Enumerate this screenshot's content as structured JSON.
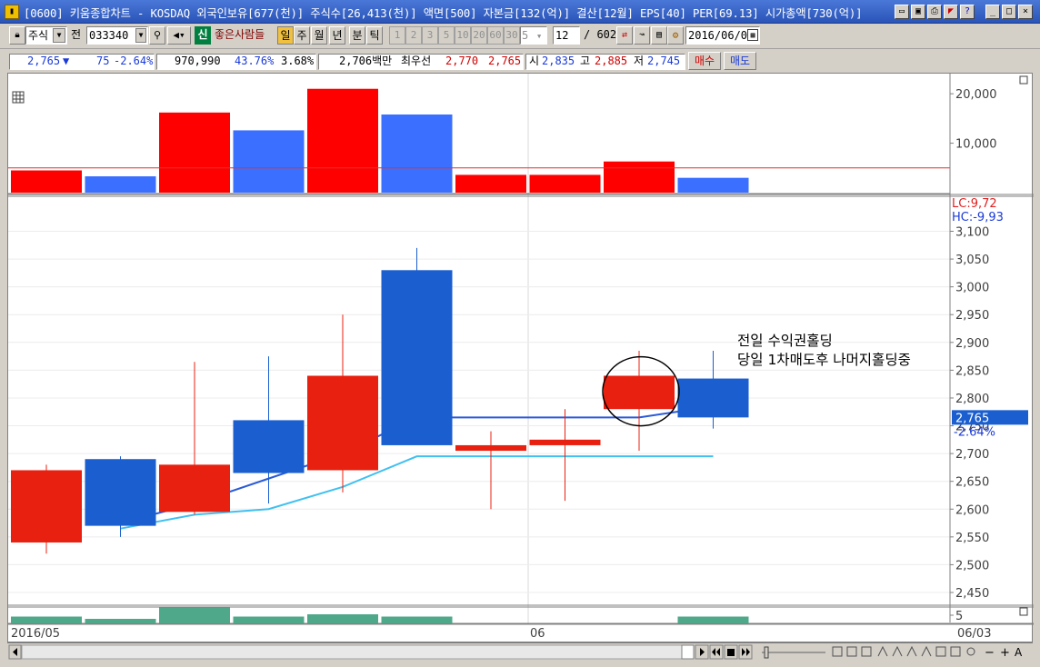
{
  "window": {
    "title": "[0600] 키움종합차트 - KOSDAQ 외국인보유[677(천)] 주식수[26,413(천)] 액면[500] 자본금[132(억)] 결산[12월] EPS[40] PER[69.13] 시가총액[730(억)]",
    "controls": [
      "_",
      "□",
      "×"
    ]
  },
  "toolbar": {
    "market_select": "주식",
    "code_prefix": "전",
    "stock_code": "033340",
    "sin_label": "신",
    "stock_name": "좋은사람들",
    "periods": [
      "일",
      "주",
      "월",
      "년",
      "분",
      "틱"
    ],
    "active_period": "일",
    "intervals": [
      "1",
      "2",
      "3",
      "5",
      "10",
      "20",
      "60",
      "30",
      "5"
    ],
    "count_value": "12",
    "count_total": "/ 602",
    "date_value": "2016/06/0"
  },
  "quote": {
    "price": "2,765",
    "arrow": "▼",
    "change": "75",
    "change_pct": "-2.64%",
    "volume": "970,990",
    "vol_ratio": "43.76%",
    "turnover": "3.68%",
    "amount": "2,706백만",
    "best_label": "최우선",
    "best_ask": "2,770",
    "best_bid": "2,765",
    "open_label": "시",
    "open": "2,835",
    "high_label": "고",
    "high": "2,885",
    "low_label": "저",
    "low": "2,745",
    "buy_btn": "매수",
    "sell_btn": "매도"
  },
  "colors": {
    "up": "#e82010",
    "down": "#1a5ecf",
    "vol_up": "#ff0000",
    "vol_down": "#3a6fff",
    "ma_short": "#2a5ad8",
    "ma_long": "#40c0f0",
    "sub_bar": "#4fa88a",
    "current": "#1a5ecf"
  },
  "chart_data": [
    {
      "type": "bar",
      "title": "volume",
      "y_ticks": [
        10000,
        20000
      ],
      "y_tick_labels": [
        "10,000",
        "20,000"
      ],
      "values": [
        4500,
        3300,
        16200,
        12600,
        21000,
        15800,
        3600,
        3600,
        6300,
        3000
      ],
      "colors": [
        "up",
        "down",
        "up",
        "down",
        "up",
        "down",
        "up",
        "up",
        "up",
        "down"
      ],
      "ref_line": 5000,
      "ylim": [
        0,
        21500
      ]
    },
    {
      "type": "candlestick",
      "x_labels": [
        "2016/05",
        "06"
      ],
      "x_label_index": [
        0,
        7
      ],
      "header_left": "LC:9,72",
      "header_right": "HC:-9,93",
      "y_tick_labels": [
        "3,100",
        "3,050",
        "3,000",
        "2,950",
        "2,900",
        "2,850",
        "2,800",
        "2,750",
        "2,700",
        "2,650",
        "2,600",
        "2,550",
        "2,500",
        "2,450"
      ],
      "y_ticks": [
        3100,
        3050,
        3000,
        2950,
        2900,
        2850,
        2800,
        2750,
        2700,
        2650,
        2600,
        2550,
        2500,
        2450
      ],
      "ylim": [
        2425,
        3115
      ],
      "candles": [
        {
          "o": 2540,
          "h": 2680,
          "l": 2520,
          "c": 2670
        },
        {
          "o": 2690,
          "h": 2695,
          "l": 2550,
          "c": 2570
        },
        {
          "o": 2595,
          "h": 2865,
          "l": 2590,
          "c": 2680
        },
        {
          "o": 2760,
          "h": 2875,
          "l": 2610,
          "c": 2665
        },
        {
          "o": 2670,
          "h": 2950,
          "l": 2630,
          "c": 2840
        },
        {
          "o": 3030,
          "h": 3070,
          "l": 2720,
          "c": 2715
        },
        {
          "o": 2705,
          "h": 2740,
          "l": 2600,
          "c": 2715
        },
        {
          "o": 2715,
          "h": 2780,
          "l": 2615,
          "c": 2725
        },
        {
          "o": 2780,
          "h": 2885,
          "l": 2705,
          "c": 2840
        },
        {
          "o": 2835,
          "h": 2885,
          "l": 2745,
          "c": 2765
        }
      ],
      "ma_short": [
        null,
        2575,
        2610,
        2655,
        2700,
        2765,
        2765,
        2765,
        2765,
        2785
      ],
      "ma_long": [
        null,
        2565,
        2590,
        2600,
        2640,
        2695,
        2695,
        2695,
        2695,
        2695
      ],
      "current_price": "2,765",
      "current_pct": "-2.64%",
      "annotation_lines": [
        "전일 수익권홀딩",
        "당일 1차매도후 나머지홀딩중"
      ],
      "circle_index": 8
    },
    {
      "type": "bar",
      "title": "sub",
      "y_tick_label": "5",
      "values": [
        3,
        2,
        7,
        3,
        4,
        3,
        0,
        0,
        0,
        3
      ]
    }
  ],
  "footer": {
    "date_right": "06/03"
  },
  "icons": {
    "grid_icon": "grid-icon",
    "app": "chart-app-icon"
  }
}
